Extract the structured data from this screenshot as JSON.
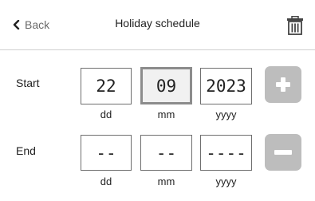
{
  "header": {
    "back_label": "Back",
    "title": "Holiday schedule",
    "back_icon": "chevron-left-icon",
    "delete_icon": "trash-icon"
  },
  "start": {
    "label": "Start",
    "day": "22",
    "month": "09",
    "year": "2023",
    "add_icon": "plus-icon"
  },
  "end": {
    "label": "End",
    "day": "--",
    "month": "--",
    "year": "----",
    "remove_icon": "minus-icon"
  },
  "units": {
    "day": "dd",
    "month": "mm",
    "year": "yyyy"
  },
  "colors": {
    "button_gray": "#bdbdbd",
    "active_field_bg": "#f1f1f1",
    "active_field_border": "#8c8c8c"
  }
}
